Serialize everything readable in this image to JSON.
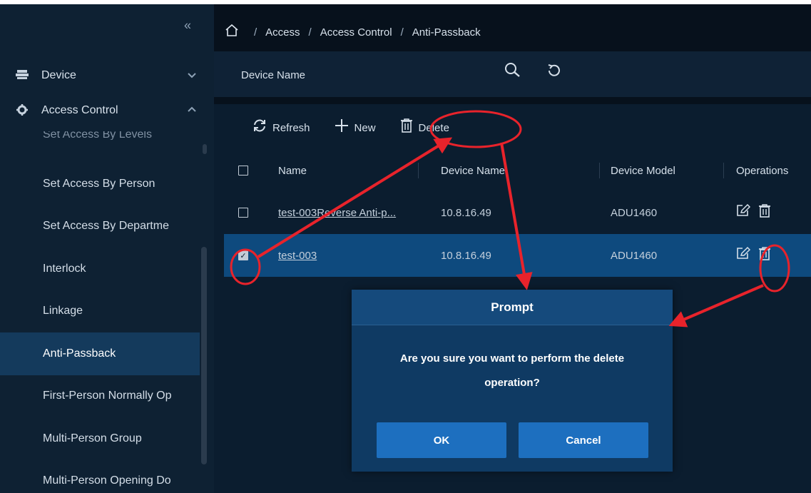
{
  "sidebar": {
    "collapse_glyph": "«",
    "groups": [
      {
        "label": "Device",
        "icon": "device-icon",
        "chevron": "⌄"
      },
      {
        "label": "Access Control",
        "icon": "gear-icon",
        "chevron": "^"
      }
    ],
    "clipped_item": "Set Access By Levels",
    "items": [
      {
        "label": "Set Access By Person"
      },
      {
        "label": "Set Access By Departme"
      },
      {
        "label": "Interlock"
      },
      {
        "label": "Linkage"
      },
      {
        "label": "Anti-Passback"
      },
      {
        "label": "First-Person Normally Op"
      },
      {
        "label": "Multi-Person Group"
      },
      {
        "label": "Multi-Person Opening Do"
      }
    ]
  },
  "breadcrumb": {
    "items": [
      "Access",
      "Access Control",
      "Anti-Passback"
    ],
    "sep": "/"
  },
  "search": {
    "label": "Device Name"
  },
  "toolbar": {
    "refresh": "Refresh",
    "new": "New",
    "delete": "Delete"
  },
  "table": {
    "headers": {
      "name": "Name",
      "device_name": "Device Name",
      "device_model": "Device Model",
      "operations": "Operations"
    },
    "rows": [
      {
        "name": "test-003Reverse Anti-p...",
        "device_name": "10.8.16.49",
        "device_model": "ADU1460",
        "checked": false
      },
      {
        "name": "test-003",
        "device_name": "10.8.16.49",
        "device_model": "ADU1460",
        "checked": true
      }
    ]
  },
  "modal": {
    "title": "Prompt",
    "line1": "Are you sure you want to perform the delete",
    "line2": "operation?",
    "ok": "OK",
    "cancel": "Cancel"
  },
  "colors": {
    "annotation": "#e8232b",
    "selected_row": "#0e4a7e",
    "button": "#1d6fbf"
  }
}
